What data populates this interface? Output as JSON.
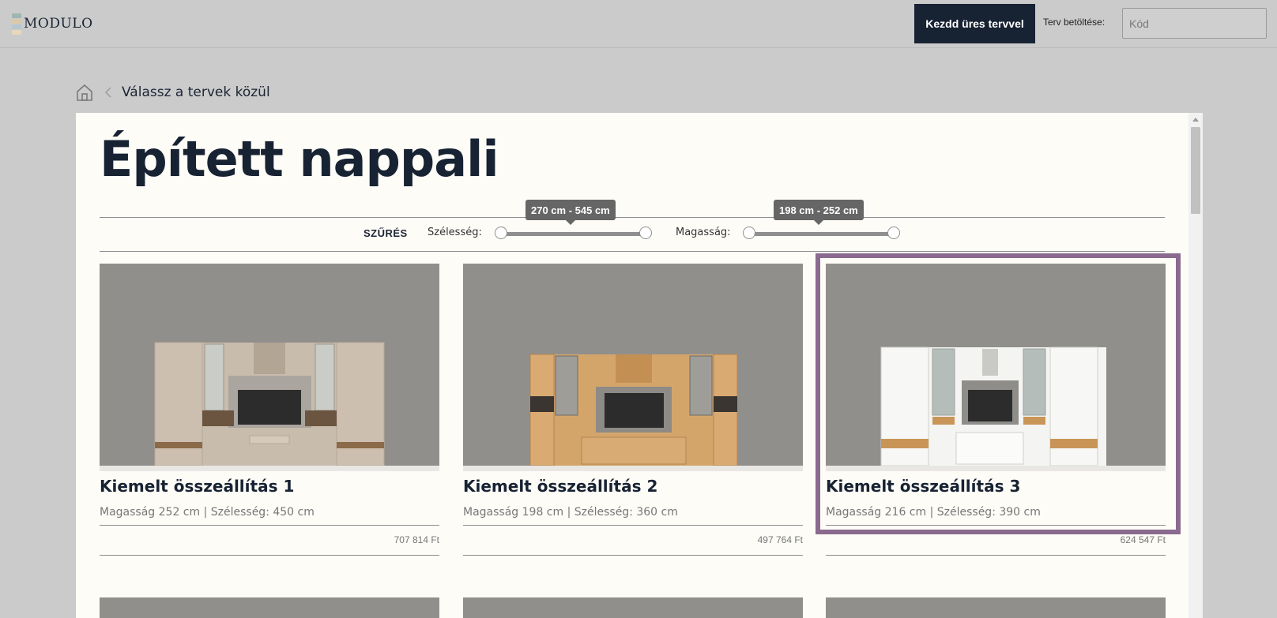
{
  "header": {
    "logo_text": "MODULO",
    "start_button": "Kezdd üres tervvel",
    "load_label": "Terv betöltése:",
    "code_placeholder": "Kód",
    "code_value": ""
  },
  "breadcrumb": {
    "home_icon": "home-icon",
    "separator_icon": "chevron-left-icon",
    "current": "Válassz a tervek közül"
  },
  "page": {
    "title": "Épített nappali"
  },
  "filter": {
    "label": "SZŰRÉS",
    "width": {
      "label": "Szélesség:",
      "tooltip": "270 cm - 545 cm",
      "min": 270,
      "max": 545
    },
    "height": {
      "label": "Magasság:",
      "tooltip": "198 cm - 252 cm",
      "min": 198,
      "max": 252
    }
  },
  "cards": [
    {
      "title": "Kiemelt összeállítás 1",
      "dims": "Magasság 252 cm | Szélesség: 450 cm",
      "price": "707 814 Ft",
      "selected": false
    },
    {
      "title": "Kiemelt összeállítás 2",
      "dims": "Magasság 198 cm | Szélesség: 360 cm",
      "price": "497 764 Ft",
      "selected": false
    },
    {
      "title": "Kiemelt összeállítás 3",
      "dims": "Magasság 216 cm | Szélesség: 390 cm",
      "price": "624 547 Ft",
      "selected": true
    }
  ],
  "colors": {
    "primary": "#172233",
    "selection": "#8b6a8f",
    "panel_bg": "#fdfcf7",
    "page_bg": "#cbcbcb"
  }
}
